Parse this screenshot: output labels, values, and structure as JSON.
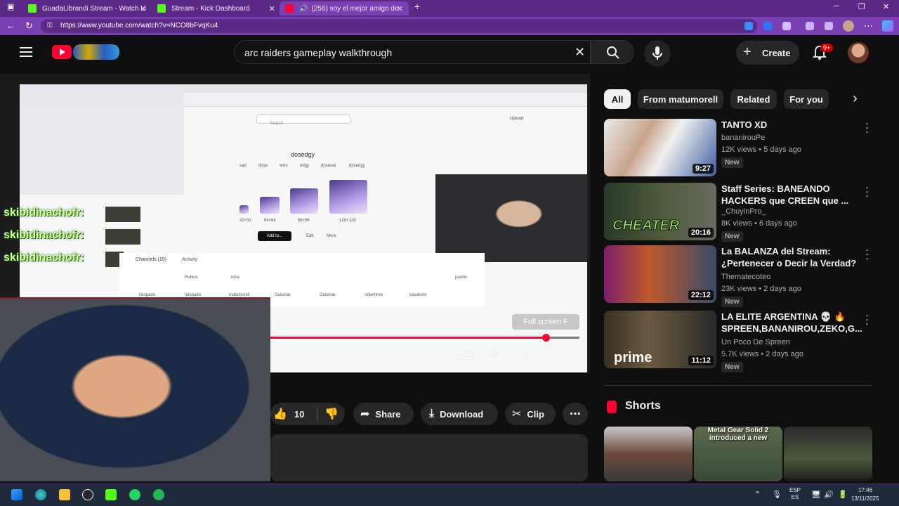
{
  "browser": {
    "tabs": [
      {
        "title": "GuadaLibrandi Stream - Watch Li"
      },
      {
        "title": "Stream - Kick Dashboard"
      },
      {
        "title": "(256) soy el mejor amigo de"
      }
    ],
    "url": "https://www.youtube.com/watch?v=NCO8bFvqKu4"
  },
  "header": {
    "search_query": "arc raiders gameplay walkthrough",
    "create_label": "Create",
    "notif_count": "9+"
  },
  "player": {
    "progress": 0.89,
    "tooltip": "Full screen  F",
    "recorded_screen": {
      "search_placeholder": "Search",
      "upload_label": "Upload",
      "title": "dosedgy",
      "tags": [
        "sad",
        "dose",
        "emo",
        "edgy",
        "dosecat",
        "dosedgy"
      ],
      "sizes": [
        "32×32",
        "64×64",
        "96×96",
        "128×128"
      ],
      "add_label": "Add to...",
      "edit_label": "Edit",
      "more_label": "More",
      "channels_tab": "Channels (15)",
      "activity_tab": "Activity",
      "channels": [
        "Rubius",
        "zeha",
        "juanlix",
        "falopado",
        "falopado",
        "matumorell",
        "Guishuu",
        "Guishuu",
        "robertinsk",
        "kovakore"
      ]
    },
    "chat": {
      "names": [
        "skibidinachofr:",
        "skibidinachofr:",
        "skibidinachofr:"
      ]
    }
  },
  "actions": {
    "likes": "10",
    "share": "Share",
    "download": "Download",
    "clip": "Clip"
  },
  "filters": [
    "All",
    "From matumorell",
    "Related",
    "For you"
  ],
  "recommendations": [
    {
      "title": "TANTO XD",
      "channel": "bananirouPe",
      "meta": "12K views • 5 days ago",
      "badge": "New",
      "duration": "9:27"
    },
    {
      "title": "Staff Series: BANEANDO HACKERS que CREEN que ...",
      "channel": "_ChuyinPro_",
      "meta": "8K views • 6 days ago",
      "badge": "New",
      "duration": "20:16",
      "thumb_text": "CHEATER"
    },
    {
      "title": "La BALANZA del Stream: ¿Pertenecer o Decir la Verdad?",
      "channel": "Thematecoteo",
      "meta": "23K views • 2 days ago",
      "badge": "New",
      "duration": "22:12"
    },
    {
      "title": "LA ELITE ARGENTINA 💀 🔥 SPREEN,BANANIROU,ZEKO,G...",
      "channel": "Un Poco De Spreen",
      "meta": "5.7K views • 2 days ago",
      "badge": "New",
      "duration": "11:12",
      "thumb_text": "prime"
    }
  ],
  "shorts": {
    "header": "Shorts",
    "items": [
      {
        "caption": ""
      },
      {
        "caption": "Metal Gear Solid 2 introduced a new"
      },
      {
        "caption": ""
      }
    ]
  },
  "taskbar": {
    "lang": "ESP\nES",
    "time": "17:46",
    "date": "13/11/2025"
  },
  "colors": {
    "accent": "#ff0033",
    "browser": "#7a3fb3",
    "bg": "#0f0f0f"
  }
}
